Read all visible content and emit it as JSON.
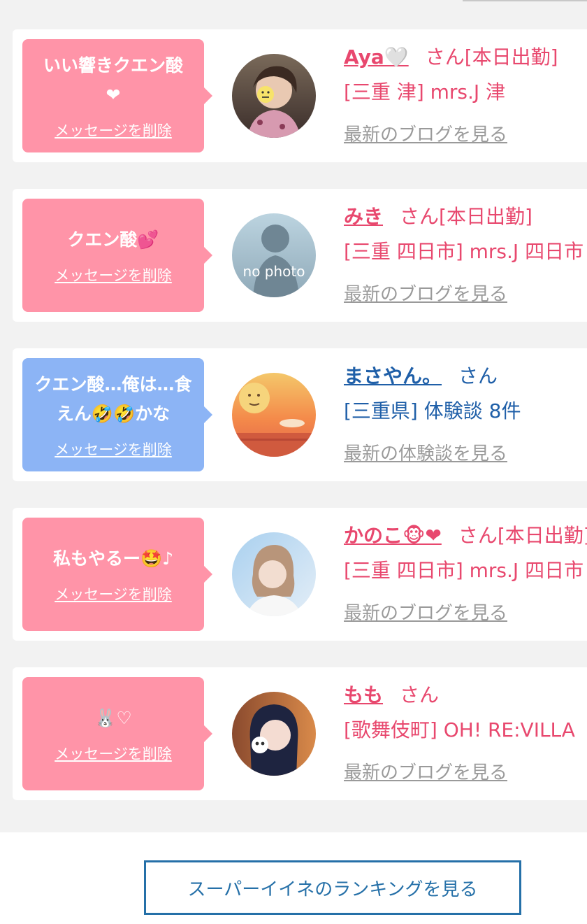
{
  "messages": [
    {
      "text": "いい響きクエン酸\n❤",
      "delete_label": "メッセージを削除",
      "avatar": "avatar-photo",
      "name": "Aya🤍",
      "suffix": "さん[本日出勤]",
      "shop": "[三重 津] mrs.J 津",
      "link": "最新のブログを見る",
      "color": "pink"
    },
    {
      "text": "クエン酸💕",
      "delete_label": "メッセージを削除",
      "avatar": "no-photo-avatar",
      "avatar_text": "no photo",
      "name": "みき",
      "suffix": "さん[本日出勤]",
      "shop": "[三重 四日市] mrs.J 四日市",
      "link": "最新のブログを見る",
      "color": "pink"
    },
    {
      "text": "クエン酸…俺は…食\nえん🤣🤣かな",
      "delete_label": "メッセージを削除",
      "avatar": "sunset-avatar",
      "name": "まさやん。",
      "suffix": "さん",
      "shop": "[三重県] 体験談 8件",
      "link": "最新の体験談を見る",
      "color": "blue"
    },
    {
      "text": "私もやるー🤩♪",
      "delete_label": "メッセージを削除",
      "avatar": "avatar-photo",
      "name": "かのこ🐵❤",
      "suffix": "さん[本日出勤]",
      "shop": "[三重 四日市] mrs.J 四日市",
      "link": "最新のブログを見る",
      "color": "pink"
    },
    {
      "text": "🐰♡",
      "delete_label": "メッセージを削除",
      "avatar": "avatar-photo",
      "name": "もも",
      "suffix": "さん",
      "shop": "[歌舞伎町] OH! RE:VILLA",
      "link": "最新のブログを見る",
      "color": "pink"
    }
  ],
  "ranking_button": "スーパーイイネのランキングを見る",
  "colors": {
    "pink_bubble": "#ff94a8",
    "blue_bubble": "#8cb4f5",
    "pink_text": "#e8486e",
    "blue_text": "#1f5fa8",
    "button_border": "#2570a8"
  }
}
